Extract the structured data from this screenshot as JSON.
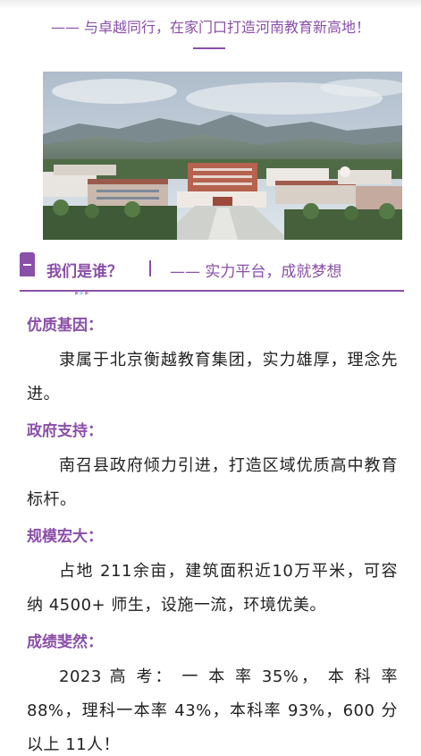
{
  "header": {
    "slogan": "—— 与卓越同行，在家门口打造河南教育新高地！"
  },
  "hero": {
    "image_desc_icon": "campus-photo"
  },
  "section": {
    "title": "我们是谁？",
    "subtitle": "—— 实力平台，成就梦想",
    "arrows": "▸▸▸"
  },
  "items": [
    {
      "title": "优质基因：",
      "body": "隶属于北京衡越教育集团，实力雄厚，理念先进。"
    },
    {
      "title": "政府支持：",
      "body": "南召县政府倾力引进，打造区域优质高中教育标杆。"
    },
    {
      "title": "规模宏大：",
      "body": "占地 211余亩，建筑面积近10万平米，可容纳 4500+ 师生，设施一流，环境优美。"
    },
    {
      "title": "成绩斐然：",
      "body": "2023 高 考：  一 本 率  35%， 本 科 率 88%，理科一本率 43%，本科率 93%，600 分以上 11人！"
    }
  ],
  "colors": {
    "accent": "#8a4fa8",
    "text": "#222222"
  }
}
